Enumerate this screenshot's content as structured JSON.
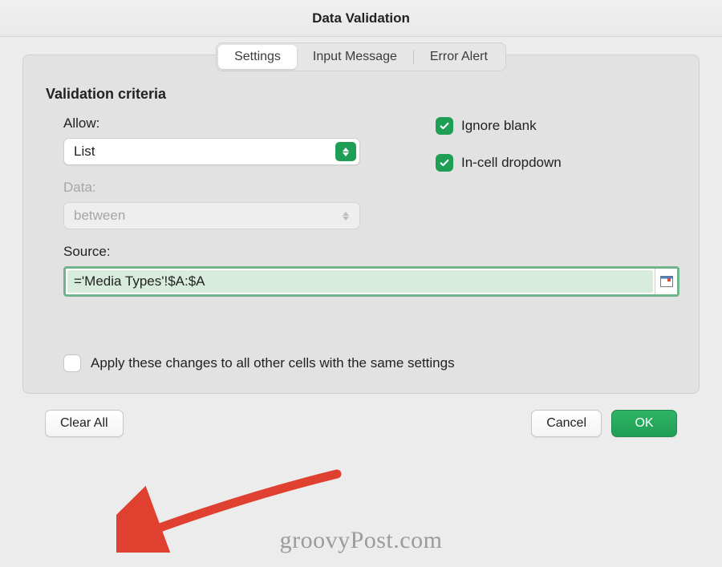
{
  "title": "Data Validation",
  "tabs": {
    "settings": "Settings",
    "input_message": "Input Message",
    "error_alert": "Error Alert"
  },
  "criteria": {
    "heading": "Validation criteria",
    "allow_label": "Allow:",
    "allow_value": "List",
    "data_label": "Data:",
    "data_value": "between",
    "source_label": "Source:",
    "source_value": "='Media Types'!$A:$A"
  },
  "options": {
    "ignore_blank": "Ignore blank",
    "incell_dropdown": "In-cell dropdown",
    "apply_all": "Apply these changes to all other cells with the same settings"
  },
  "buttons": {
    "clear_all": "Clear All",
    "cancel": "Cancel",
    "ok": "OK"
  },
  "watermark": "groovyPost.com",
  "colors": {
    "accent_green": "#1f9e55"
  }
}
